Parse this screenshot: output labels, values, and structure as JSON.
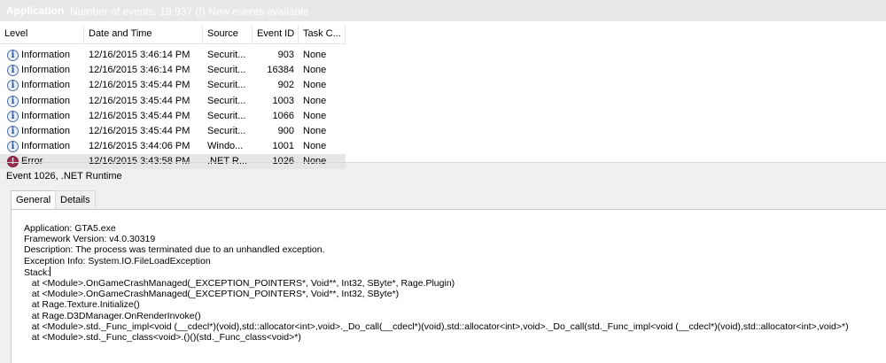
{
  "title_bar": {
    "log_name": "Application",
    "info": "Number of events: 19,937 (!) New events available"
  },
  "table": {
    "columns": [
      "Level",
      "Date and Time",
      "Source",
      "Event ID",
      "Task C..."
    ],
    "rows": [
      {
        "level": "Information",
        "date": "12/16/2015 3:46:14 PM",
        "source": "Securit...",
        "event_id": "903",
        "task": "None",
        "icon": "info-icon"
      },
      {
        "level": "Information",
        "date": "12/16/2015 3:46:14 PM",
        "source": "Securit...",
        "event_id": "16384",
        "task": "None",
        "icon": "info-icon"
      },
      {
        "level": "Information",
        "date": "12/16/2015 3:45:44 PM",
        "source": "Securit...",
        "event_id": "902",
        "task": "None",
        "icon": "info-icon"
      },
      {
        "level": "Information",
        "date": "12/16/2015 3:45:44 PM",
        "source": "Securit...",
        "event_id": "1003",
        "task": "None",
        "icon": "info-icon"
      },
      {
        "level": "Information",
        "date": "12/16/2015 3:45:44 PM",
        "source": "Securit...",
        "event_id": "1066",
        "task": "None",
        "icon": "info-icon"
      },
      {
        "level": "Information",
        "date": "12/16/2015 3:45:44 PM",
        "source": "Securit...",
        "event_id": "900",
        "task": "None",
        "icon": "info-icon"
      },
      {
        "level": "Information",
        "date": "12/16/2015 3:44:06 PM",
        "source": "Windo...",
        "event_id": "1001",
        "task": "None",
        "icon": "info-icon"
      },
      {
        "level": "Error",
        "date": "12/16/2015 3:43:58 PM",
        "source": ".NET R...",
        "event_id": "1026",
        "task": "None",
        "icon": "error-icon",
        "selected": true
      }
    ]
  },
  "event_detail": {
    "title": "Event 1026, .NET Runtime",
    "tabs": [
      "General",
      "Details"
    ],
    "lines": [
      "Application: GTA5.exe",
      "Framework Version: v4.0.30319",
      "Description: The process was terminated due to an unhandled exception.",
      "Exception Info: System.IO.FileLoadException",
      "Stack:",
      "   at <Module>.OnGameCrashManaged(_EXCEPTION_POINTERS*, Void**, Int32, SByte*, Rage.Plugin)",
      "   at <Module>.OnGameCrashManaged(_EXCEPTION_POINTERS*, Void**, Int32, SByte*)",
      "   at Rage.Texture.Initialize()",
      "   at Rage.D3DManager.OnRenderInvoke()",
      "   at <Module>.std._Func_impl<void (__cdecl*)(void),std::allocator<int>,void>._Do_call(__cdecl*)(void),std::allocator<int>,void>._Do_call(std._Func_impl<void (__cdecl*)(void),std::allocator<int>,void>*)",
      "   at <Module>.std._Func_class<void>.()()(std._Func_class<void>*)"
    ]
  },
  "colors": {
    "info_icon": "#2a4f8a",
    "error_icon": "#9b2c55",
    "selected_row": "#e6e6e6"
  }
}
